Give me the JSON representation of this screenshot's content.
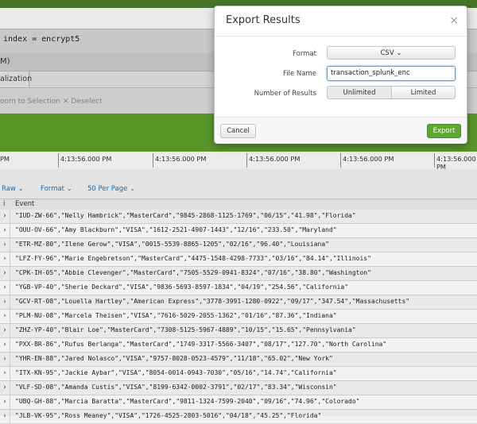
{
  "search": {
    "query": "index = encrypt5"
  },
  "timebar": {
    "text": "M)"
  },
  "tabs": {
    "visualization": "alization"
  },
  "selection": {
    "zoom_to_selection": "oom to Selection",
    "deselect": "✕ Deselect"
  },
  "timeline": {
    "ticks": [
      "PM",
      "4:13:56.000 PM",
      "4:13:56.000 PM",
      "4:13:56.000 PM",
      "4:13:56.000 PM",
      "4:13:56.000 PM"
    ]
  },
  "results_options": {
    "raw": "Raw ⌄",
    "format": "Format ⌄",
    "per_page": "50 Per Page ⌄"
  },
  "table": {
    "col_i": "i",
    "col_event": "Event",
    "rows": [
      "\"IUD-ZW-66\",\"Nelly Hambrick\",\"MasterCard\",\"9845-2868-1125-1769\",\"06/15\",\"41.98\",\"Florida\"",
      "\"OUU-OV-66\",\"Amy Blackburn\",\"VISA\",\"1612-2521-4907-1443\",\"12/16\",\"233.50\",\"Maryland\"",
      "\"ETR-MZ-80\",\"Ilene Gerow\",\"VISA\",\"0015-5539-8865-1205\",\"02/16\",\"96.40\",\"Louisiana\"",
      "\"LFZ-FY-96\",\"Marie Engebretson\",\"MasterCard\",\"4475-1548-4298-7733\",\"03/16\",\"84.14\",\"Illinois\"",
      "\"CPK-IH-05\",\"Abbie Clevenger\",\"MasterCard\",\"7505-5529-0941-8324\",\"07/16\",\"38.80\",\"Washington\"",
      "\"YGB-VP-40\",\"Sherie Deckard\",\"VISA\",\"9836-5693-8597-1834\",\"04/19\",\"254.56\",\"California\"",
      "\"GCV-RT-08\",\"Louella Hartley\",\"American Express\",\"3778-3991-1280-0922\",\"09/17\",\"347.54\",\"Massachusetts\"",
      "\"PLM-NU-08\",\"Marcela Theisen\",\"VISA\",\"7616-5029-2055-1362\",\"01/16\",\"87.36\",\"Indiana\"",
      "\"ZHZ-YP-40\",\"Blair Loe\",\"MasterCard\",\"7308-5125-5967-4889\",\"10/15\",\"15.65\",\"Pennsylvania\"",
      "\"PXX-BR-86\",\"Rufus Berlanga\",\"MasterCard\",\"1749-3317-5566-3407\",\"08/17\",\"127.70\",\"North Carolina\"",
      "\"YHR-EN-88\",\"Jared Nolasco\",\"VISA\",\"9757-8028-0523-4579\",\"11/18\",\"65.02\",\"New York\"",
      "\"ITX-KN-95\",\"Jackie Aybar\",\"VISA\",\"8054-0014-0943-7030\",\"05/16\",\"14.74\",\"California\"",
      "\"VLF-SD-08\",\"Amanda Custis\",\"VISA\",\"8199-6342-0002-3791\",\"02/17\",\"83.34\",\"Wisconsin\"",
      "\"UBQ-GH-88\",\"Marcia Baratta\",\"MasterCard\",\"9811-1324-7599-2040\",\"09/16\",\"74.96\",\"Colorado\"",
      "\"JLB-VK-95\",\"Ross Meaney\",\"VISA\",\"1726-4525-2803-5016\",\"04/18\",\"45.25\",\"Florida\""
    ]
  },
  "modal": {
    "title": "Export Results",
    "close": "×",
    "format_label": "Format",
    "format_value": "CSV ⌄",
    "filename_label": "File Name",
    "filename_value": "transaction_splunk_enc",
    "num_results_label": "Number of Results",
    "unlimited": "Unlimited",
    "limited": "Limited",
    "cancel": "Cancel",
    "export": "Export"
  }
}
